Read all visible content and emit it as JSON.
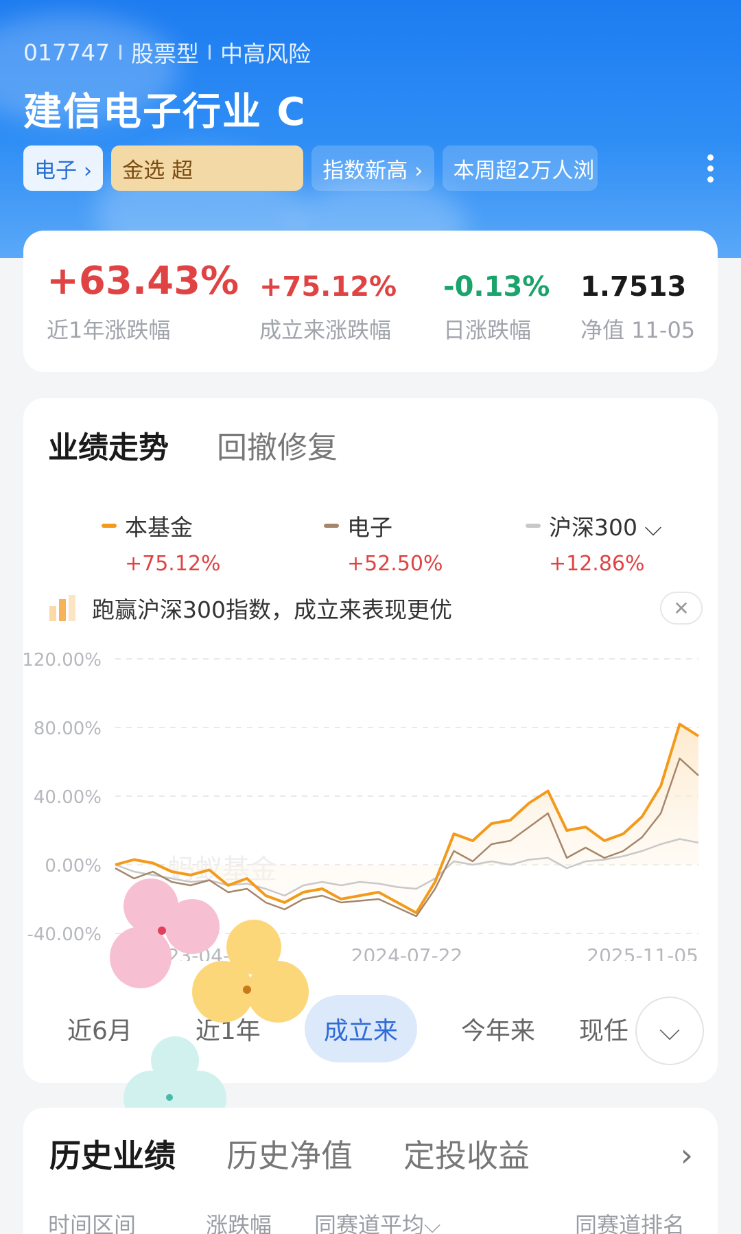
{
  "header": {
    "code": "017747",
    "type": "股票型",
    "risk": "中高风险",
    "fund_name": "建信电子行业 C",
    "tags": [
      "电子 ›",
      "金选 超",
      "指数新高 ›",
      "本周超2万人浏"
    ]
  },
  "stats": [
    {
      "value": "+63.43%",
      "label": "近1年涨跌幅",
      "color": "#e04343"
    },
    {
      "value": "+75.12%",
      "label": "成立来涨跌幅",
      "color": "#e04343"
    },
    {
      "value": "-0.13%",
      "label": "日涨跌幅",
      "color": "#1aa36b"
    },
    {
      "value": "1.7513",
      "label": "净值 11-05",
      "color": "#1a1a1a"
    }
  ],
  "performance": {
    "tabs": [
      "业绩走势",
      "回撤修复"
    ],
    "legend": [
      {
        "name": "本基金",
        "pct": "+75.12%",
        "color": "#f39a1b"
      },
      {
        "name": "电子",
        "pct": "+52.50%",
        "color": "#a6866b"
      },
      {
        "name": "沪深300 ⌵",
        "pct": "+12.86%",
        "color": "#c8c8c8"
      }
    ],
    "banner": "跑赢沪深300指数，成立来表现更优",
    "close": "✕",
    "watermark": "蚂蚁基金",
    "ranges": [
      "近6月",
      "近1年",
      "成立来",
      "今年来",
      "现任"
    ],
    "expand": "⌵"
  },
  "chart_data": {
    "type": "line",
    "ylim": [
      -40,
      120
    ],
    "yticks": [
      "120.00%",
      "80.00%",
      "40.00%",
      "0.00%",
      "-40.00%"
    ],
    "xticks": [
      "2023-04-1",
      "2024-07-22",
      "2025-11-05"
    ],
    "x": [
      "2023-04-11",
      "2023-05-15",
      "2023-06-15",
      "2023-07-15",
      "2023-08-15",
      "2023-09-15",
      "2023-10-15",
      "2023-11-15",
      "2023-12-15",
      "2024-01-15",
      "2024-02-15",
      "2024-03-15",
      "2024-04-15",
      "2024-05-15",
      "2024-06-15",
      "2024-07-22",
      "2024-08-15",
      "2024-09-15",
      "2024-10-08",
      "2024-11-15",
      "2024-12-15",
      "2025-01-15",
      "2025-02-15",
      "2025-03-15",
      "2025-04-08",
      "2025-05-15",
      "2025-06-15",
      "2025-07-15",
      "2025-08-15",
      "2025-09-15",
      "2025-10-15",
      "2025-11-05"
    ],
    "series": [
      {
        "name": "本基金",
        "color": "#f39a1b",
        "values": [
          0,
          3,
          1,
          -4,
          -6,
          -3,
          -12,
          -8,
          -18,
          -22,
          -16,
          -14,
          -20,
          -18,
          -16,
          -22,
          -28,
          -10,
          18,
          14,
          24,
          26,
          36,
          43,
          20,
          22,
          14,
          18,
          28,
          46,
          82,
          75
        ]
      },
      {
        "name": "电子",
        "color": "#a6866b",
        "values": [
          -2,
          -8,
          -4,
          -10,
          -12,
          -9,
          -16,
          -14,
          -22,
          -26,
          -20,
          -18,
          -22,
          -21,
          -20,
          -25,
          -30,
          -14,
          8,
          2,
          12,
          14,
          22,
          30,
          4,
          10,
          4,
          8,
          16,
          30,
          62,
          52
        ]
      },
      {
        "name": "沪深300",
        "color": "#c8c8c8",
        "values": [
          0,
          -4,
          -6,
          -8,
          -10,
          -9,
          -12,
          -11,
          -14,
          -18,
          -12,
          -10,
          -12,
          -10,
          -11,
          -13,
          -14,
          -8,
          2,
          0,
          2,
          0,
          3,
          4,
          -2,
          2,
          3,
          5,
          8,
          12,
          15,
          12.86
        ]
      }
    ]
  },
  "history": {
    "tabs": [
      "历史业绩",
      "历史净值",
      "定投收益"
    ],
    "arrow": "›",
    "columns": [
      "时间区间",
      "涨跌幅",
      "同赛道平均⌵",
      "同赛道排名"
    ]
  }
}
